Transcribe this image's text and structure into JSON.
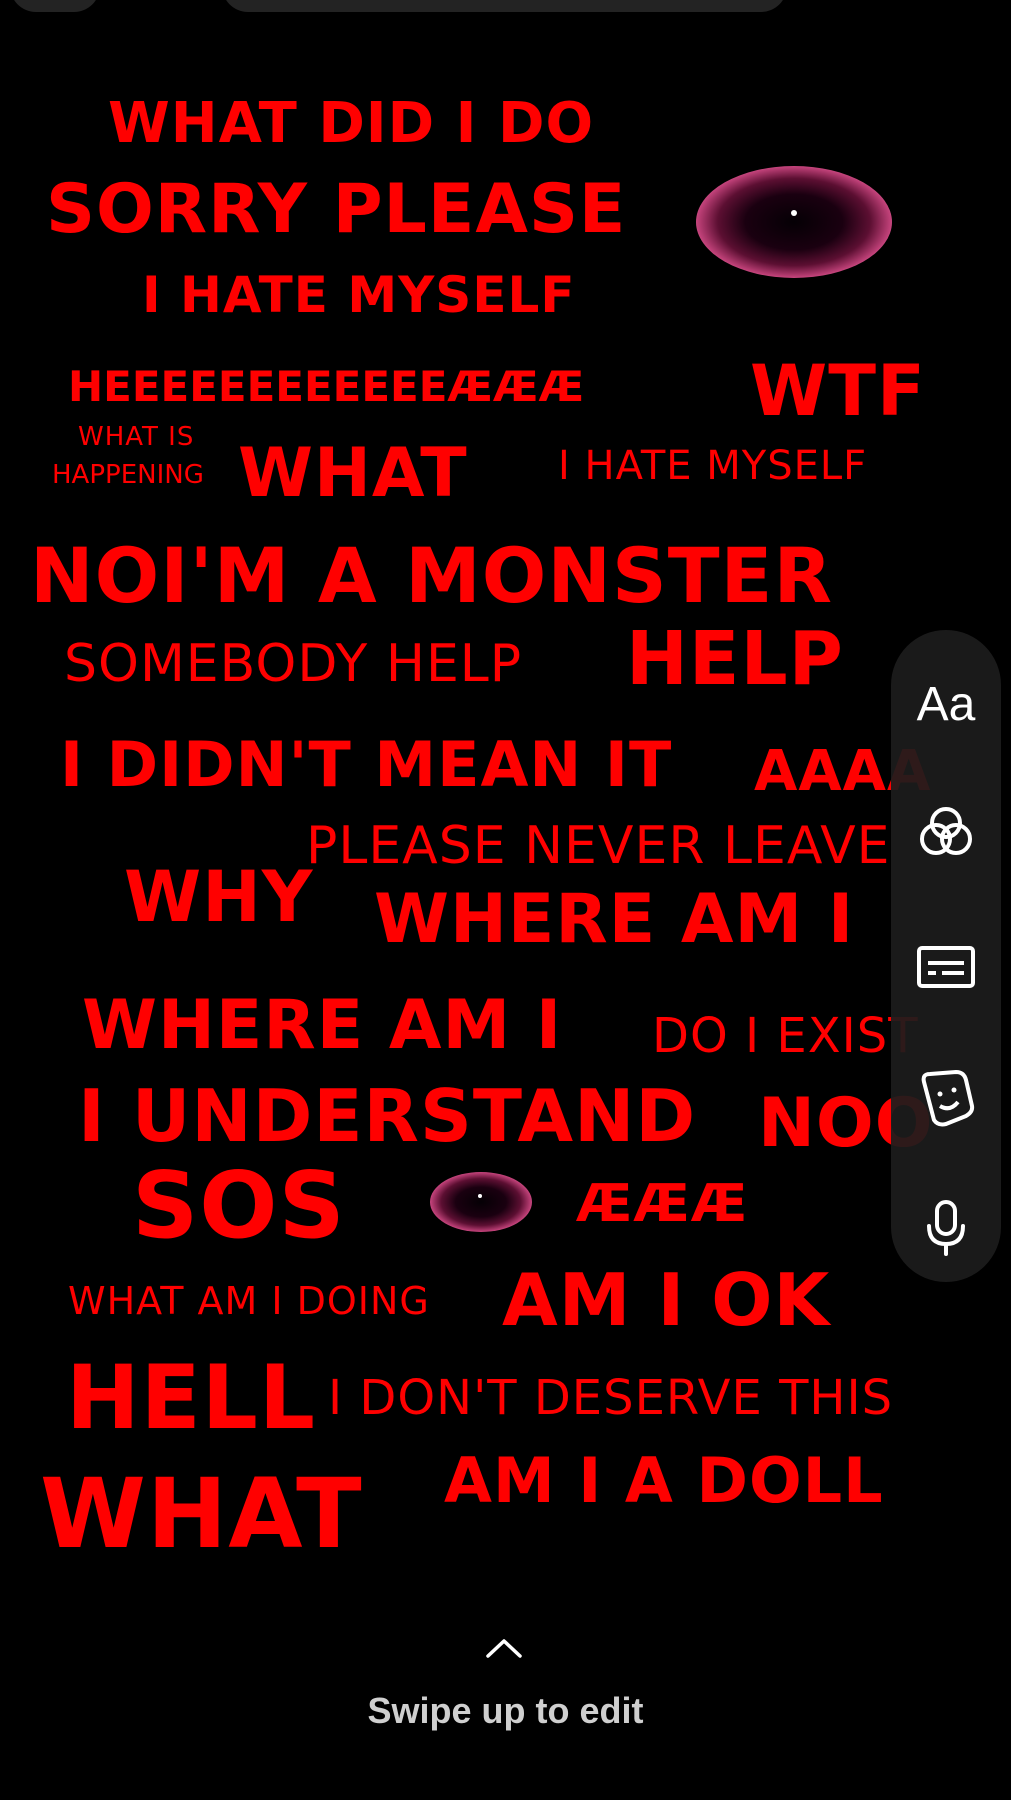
{
  "story_text": {
    "line01": "WHAT DID I DO",
    "line02": "SORRY PLEASE",
    "line03": "I HATE MYSELF",
    "line04": "HEEEEEEEEEEEEÆÆÆ",
    "line05": "WTF",
    "line06": "WHAT IS",
    "line07": "HAPPENING",
    "line08": "WHAT",
    "line09": "I HATE MYSELF",
    "line10": "NOI'M A MONSTER",
    "line11": "SOMEBODY HELP",
    "line12": "HELP",
    "line13": "I DIDN'T MEAN IT",
    "line14": "AAAA",
    "line15": "PLEASE NEVER LEAVE",
    "line16": "WHY",
    "line17": "WHERE AM I",
    "line18": "WHERE AM I",
    "line19": "DO I EXIST",
    "line20": "I UNDERSTAND",
    "line21": "NOO",
    "line22": "SOS",
    "line23": "ÆÆÆ",
    "line24": "WHAT AM I DOING",
    "line25": "AM I OK",
    "line26": "HELL",
    "line27": "I DON'T DESERVE THIS",
    "line28": "WHAT",
    "line29": "AM I A DOLL"
  },
  "tool_rail": {
    "text_tool_label": "Aa",
    "icons": [
      "filters-icon",
      "captions-icon",
      "sticker-icon",
      "microphone-icon"
    ]
  },
  "footer": {
    "swipe_hint": "Swipe up to edit",
    "chevron_icon": "chevron-up-icon"
  },
  "colors": {
    "background": "#000000",
    "text_red": "#ff0000",
    "rail_background": "#1c1c1c",
    "hint_text": "#cfcfcf"
  }
}
